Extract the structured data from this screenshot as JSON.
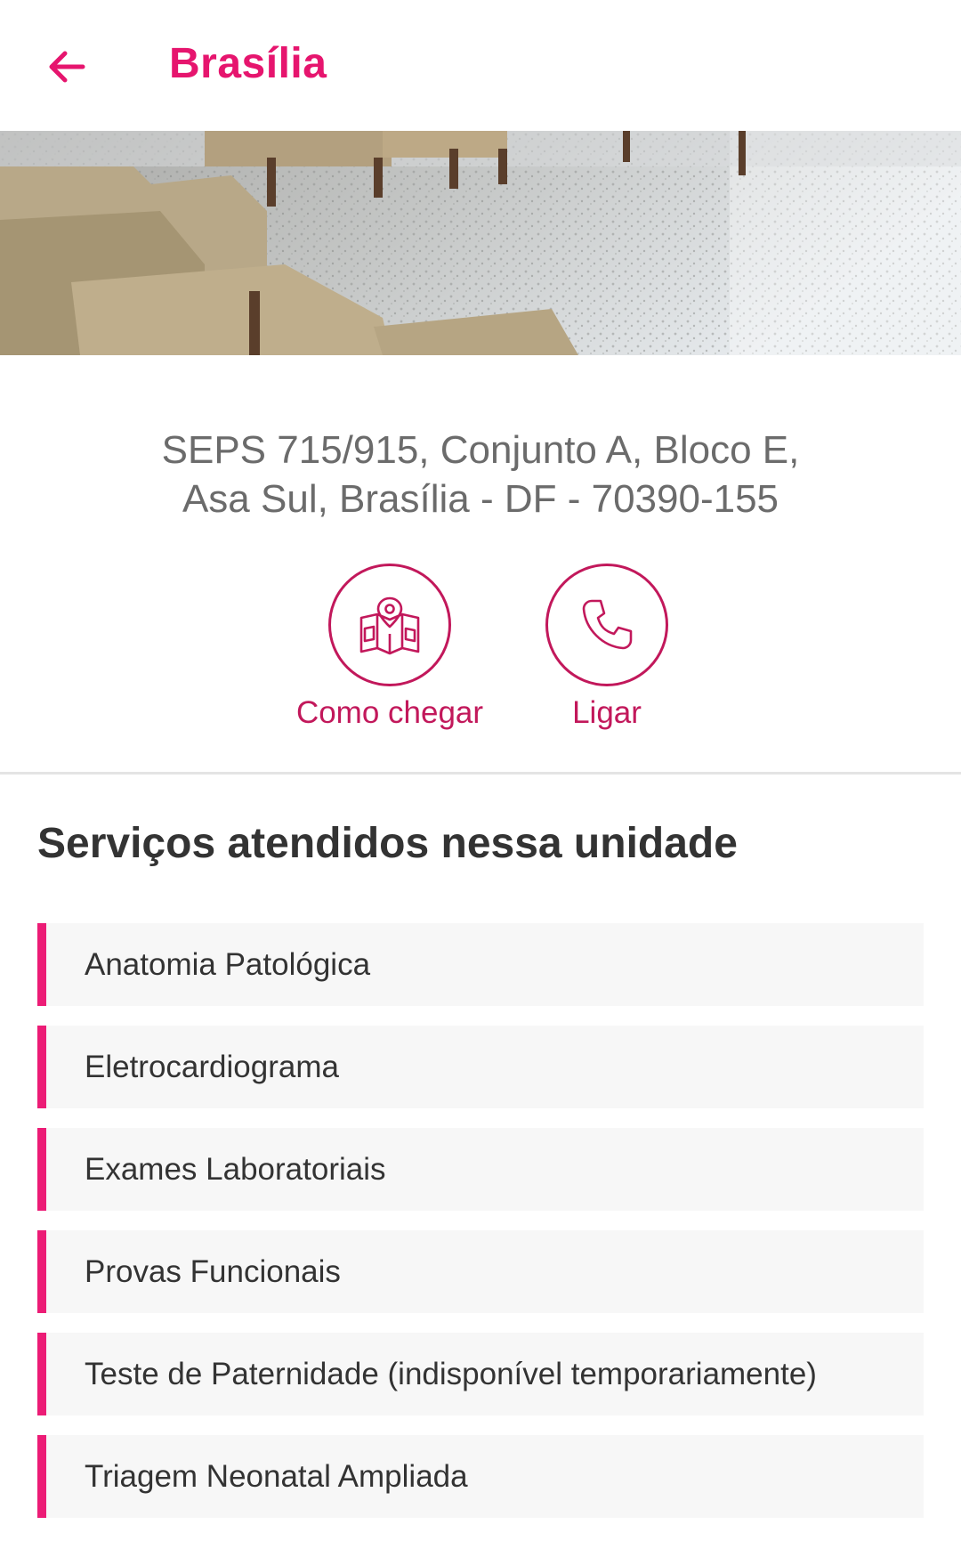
{
  "header": {
    "title": "Brasília",
    "back_icon": "arrow-left-icon"
  },
  "colors": {
    "accent": "#e6156e",
    "action": "#c2185b",
    "service_bar": "#ec1c76"
  },
  "address": {
    "line1": "SEPS 715/915, Conjunto A, Bloco E,",
    "line2": "Asa Sul, Brasília - DF - 70390-155"
  },
  "actions": {
    "directions": {
      "label": "Como chegar",
      "icon": "map-pin-icon"
    },
    "call": {
      "label": "Ligar",
      "icon": "phone-icon"
    }
  },
  "services": {
    "title": "Serviços atendidos nessa unidade",
    "items": [
      {
        "label": "Anatomia Patológica"
      },
      {
        "label": "Eletrocardiograma"
      },
      {
        "label": "Exames Laboratoriais"
      },
      {
        "label": "Provas Funcionais"
      },
      {
        "label": "Teste de Paternidade (indisponível temporariamente)"
      },
      {
        "label": "Triagem Neonatal Ampliada"
      }
    ]
  }
}
